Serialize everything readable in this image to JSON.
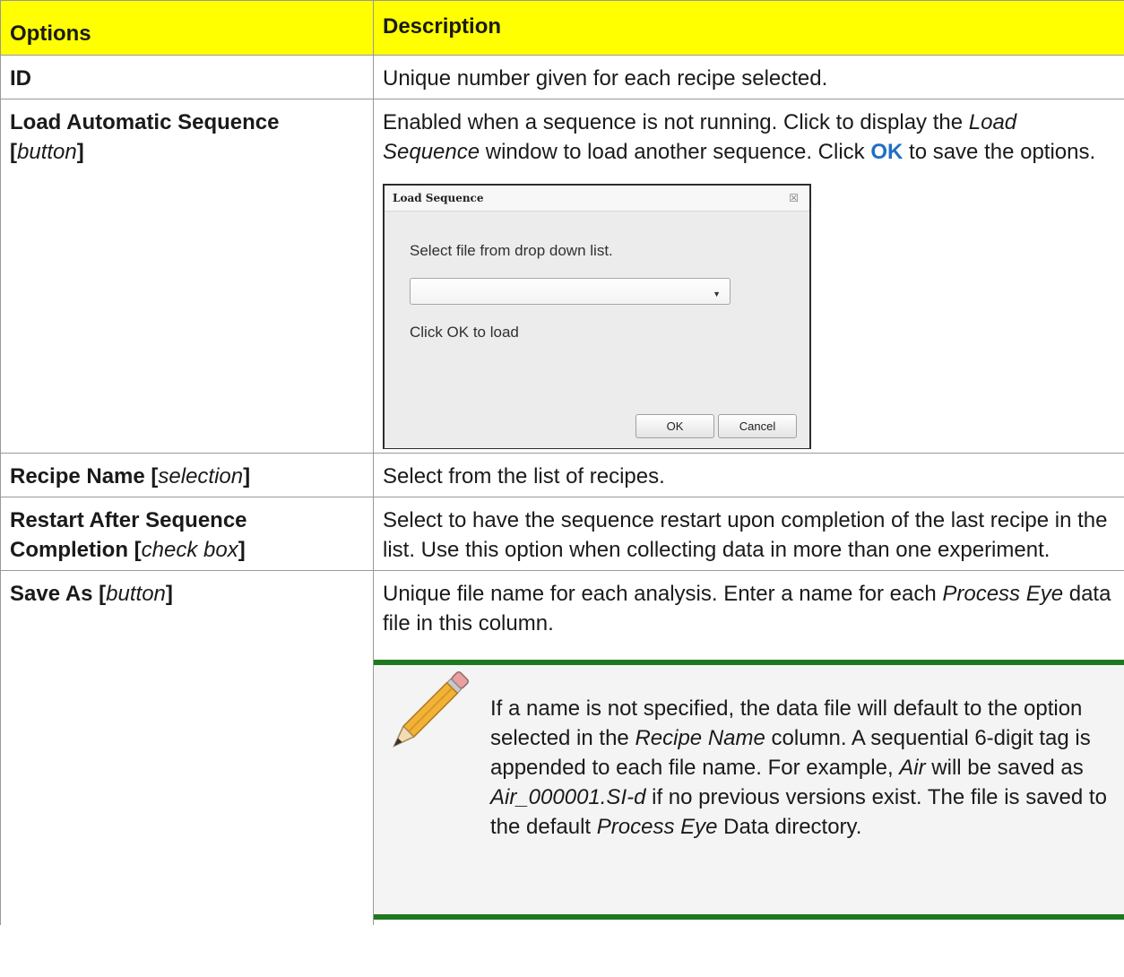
{
  "table": {
    "headers": {
      "options": "Options",
      "description": "Description"
    },
    "rows": {
      "id": {
        "option": "ID",
        "description": "Unique number given for each recipe selected."
      },
      "load": {
        "option_bold": "Load Automatic Sequence",
        "option_open": "[",
        "option_type": "button",
        "option_close": "]",
        "desc_part1": "Enabled when a sequence is not running. Click to display the ",
        "desc_italic": "Load Sequence",
        "desc_part2": " window to load another sequence. Click ",
        "desc_ok": "OK",
        "desc_part3": " to save the options."
      },
      "recipe": {
        "option_bold": "Recipe Name [",
        "option_type": "selection",
        "option_close": "]",
        "description": "Select from the list of recipes."
      },
      "restart": {
        "option_bold": "Restart After Sequence Completion [",
        "option_type": "check box",
        "option_close": "]",
        "description": "Select to have the sequence restart upon completion of the last recipe in the list. Use this option when collecting data in more than one experiment."
      },
      "saveas": {
        "option_bold": "Save As [",
        "option_type": "button",
        "option_close": "]",
        "desc_part1": "Unique file name for each analysis. Enter a name for each ",
        "desc_italic": "Process Eye",
        "desc_part2": " data file in this column."
      }
    }
  },
  "dialog": {
    "title": "Load Sequence",
    "close_glyph": "☒",
    "prompt": "Select file from drop down list.",
    "dropdown_value": "",
    "hint": "Click OK to load",
    "ok": "OK",
    "cancel": "Cancel"
  },
  "note": {
    "icon": "pencil-icon",
    "s1": "If a name is not specified, the data file will default to the option selected in the ",
    "s1_italic": "Recipe Name",
    "s2": " column. A sequential 6-digit tag is appended to each file name. For example, ",
    "ex1": "Air",
    "s3": " will be saved as ",
    "ex2": "Air_000001.SI-d",
    "s4": " if no previous versions exist. The file is saved to the default ",
    "s4_italic": "Process Eye",
    "s5": " Data directory."
  },
  "colors": {
    "header_bg": "#ffff00",
    "note_border": "#1e7a1e",
    "ok_link": "#1f6fc5"
  }
}
